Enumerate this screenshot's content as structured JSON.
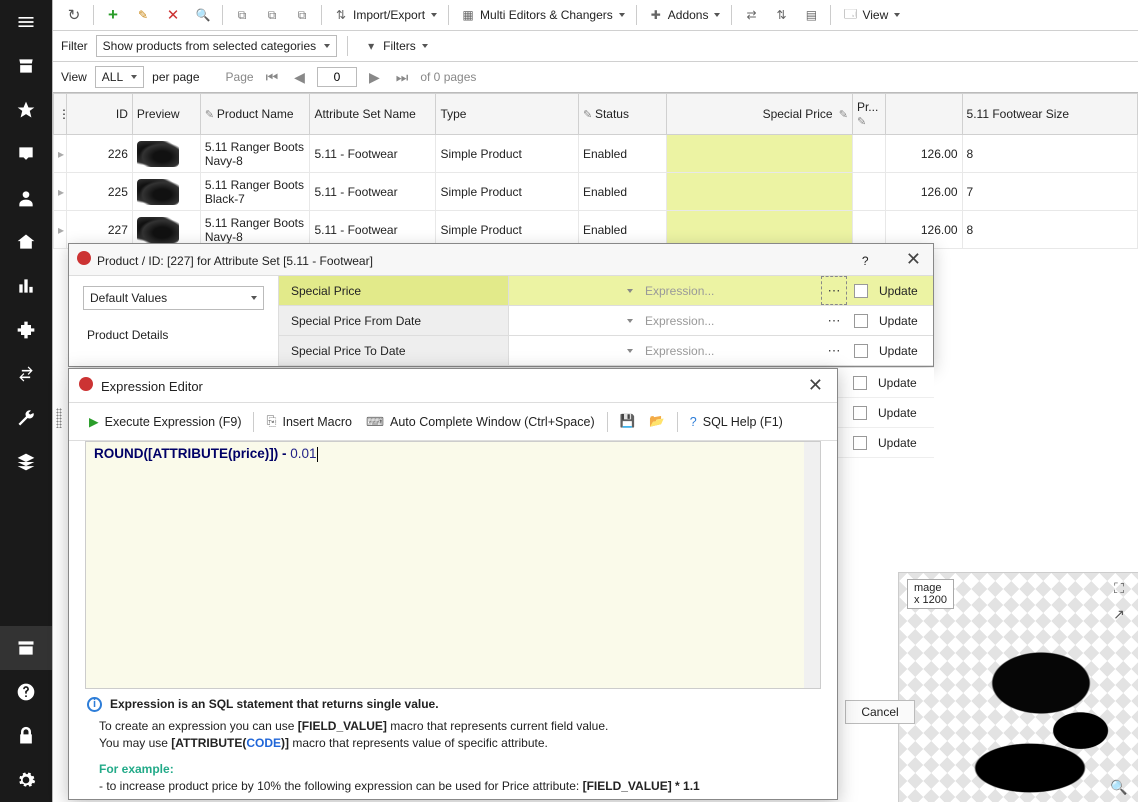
{
  "rail": {
    "items": [
      "menu",
      "store",
      "star",
      "inbox",
      "user",
      "house",
      "chart",
      "puzzle",
      "swap",
      "wrench",
      "layers"
    ],
    "bottom": [
      "archive",
      "help",
      "lock",
      "gear"
    ]
  },
  "toolbar": {
    "refresh": "↻",
    "add": "+",
    "edit": "✎",
    "delete": "✕",
    "search": "🔍",
    "copy": "⧉",
    "paste": "⧉",
    "clone": "⧉",
    "import_export": "Import/Export",
    "multi": "Multi Editors & Changers",
    "addons": "Addons",
    "view": "View"
  },
  "filter": {
    "label": "Filter",
    "selected": "Show products from selected categories",
    "filters_btn": "Filters"
  },
  "pager": {
    "view": "View",
    "all": "ALL",
    "perpage": "per page",
    "page": "Page",
    "page_value": "0",
    "of": "of 0 pages"
  },
  "grid": {
    "headers": {
      "id": "ID",
      "preview": "Preview",
      "name": "Product Name",
      "aset": "Attribute Set Name",
      "type": "Type",
      "status": "Status",
      "sp": "Special Price",
      "pr": "Pr...",
      "ps": "",
      "size": "5.11 Footwear Size"
    },
    "rows": [
      {
        "id": "226",
        "name": "5.11 Ranger Boots Navy-8",
        "aset": "5.11 - Footwear",
        "type": "Simple Product",
        "status": "Enabled",
        "price": "126.00",
        "size": "8"
      },
      {
        "id": "225",
        "name": "5.11 Ranger Boots Black-7",
        "aset": "5.11 - Footwear",
        "type": "Simple Product",
        "status": "Enabled",
        "price": "126.00",
        "size": "7"
      },
      {
        "id": "227",
        "name": "5.11 Ranger Boots Navy-8",
        "aset": "5.11 - Footwear",
        "type": "Simple Product",
        "status": "Enabled",
        "price": "126.00",
        "size": "8"
      }
    ]
  },
  "panel": {
    "title": "Product / ID: [227] for Attribute Set [5.11 - Footwear]",
    "help": "?",
    "left_combo": "Default Values",
    "left_label": "Product Details",
    "attrs": [
      {
        "label": "Special Price",
        "placeholder": "Expression...",
        "hl": true,
        "dots_hl": true
      },
      {
        "label": "Special Price From Date",
        "placeholder": "Expression..."
      },
      {
        "label": "Special Price To Date",
        "placeholder": "Expression..."
      }
    ],
    "update": "Update",
    "cancel": "Cancel"
  },
  "expr": {
    "title": "Expression Editor",
    "exec": "Execute Expression (F9)",
    "macro": "Insert Macro",
    "autocomplete": "Auto Complete Window (Ctrl+Space)",
    "sqlhelp": "SQL Help (F1)",
    "code_pre": "ROUND([ATTRIBUTE(price)]) - ",
    "code_num": "0.01",
    "info": "Expression is an SQL statement that returns single value.",
    "help1a": "To create an expression you can use ",
    "help1b": "[FIELD_VALUE]",
    "help1c": " macro that represents current field value.",
    "help2a": "You may use ",
    "help2b": "[ATTRIBUTE(",
    "help2c": "CODE",
    "help2d": ")]",
    "help2e": " macro that represents value of specific attribute.",
    "example": "For example:",
    "example_line": "   - to increase product price by 10% the following expression can be used for Price attribute: ",
    "example_bold": "[FIELD_VALUE] * 1.1"
  },
  "preview": {
    "label": "mage\nx 1200"
  }
}
